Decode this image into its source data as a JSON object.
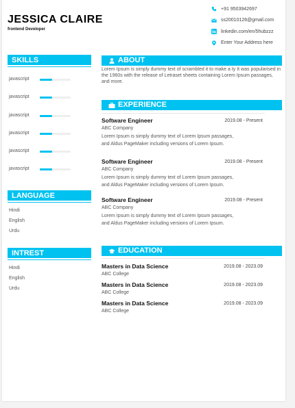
{
  "header": {
    "name": "JESSICA CLAIRE",
    "role": "frontend Developer"
  },
  "contact": [
    {
      "icon": "phone-icon",
      "text": "+91 9503942697"
    },
    {
      "icon": "email-icon",
      "text": "ss20010126@gmail.com"
    },
    {
      "icon": "linkedin-icon",
      "text": "linkedin.com/en/5hubzzz"
    },
    {
      "icon": "location-pin-icon",
      "text": "Enter Your Address here"
    }
  ],
  "colors": {
    "accent": "#00c2f0"
  },
  "skills": {
    "title": "SKILLS",
    "items": [
      {
        "label": "javascript",
        "level": 0.4
      },
      {
        "label": "javascript",
        "level": 0.4
      },
      {
        "label": "javascript",
        "level": 0.4
      },
      {
        "label": "javascript",
        "level": 0.4
      },
      {
        "label": "javascript",
        "level": 0.4
      },
      {
        "label": "javascript",
        "level": 0.4
      }
    ]
  },
  "language": {
    "title": "LANGUAGE",
    "items": [
      "Hindi",
      "English",
      "Urdu"
    ]
  },
  "interest": {
    "title": "INTREST",
    "items": [
      "Hindi",
      "English",
      "Urdu"
    ]
  },
  "about": {
    "title": "ABOUT",
    "text": "Lorem Ipsum is simply dummy text of scrambled it to make a ty It was popularised in the 1960s with the release of Letraset sheets containing Lorem Ipsum passages, and more."
  },
  "experience": {
    "title": "EXPERIENCE",
    "items": [
      {
        "title": "Software Engineer",
        "date": "2019.08 - Present",
        "company": "ABC Company",
        "desc": "Lorem Ipsum is simply dummy text of Lorem Ipsum passages, and Aldus PageMaker including versions of Lorem Ipsum."
      },
      {
        "title": "Software Engineer",
        "date": "2019.08 - Present",
        "company": "ABC Company",
        "desc": "Lorem Ipsum is simply dummy text of Lorem Ipsum passages, and Aldus PageMaker including versions of Lorem Ipsum."
      },
      {
        "title": "Software Engineer",
        "date": "2019.08 - Present",
        "company": "ABC Company",
        "desc": "Lorem Ipsum is simply dummy text of Lorem Ipsum passages, and Aldus PageMaker including versions of Lorem Ipsum."
      }
    ]
  },
  "education": {
    "title": "EDUCATION",
    "items": [
      {
        "degree": "Masters in Data Science",
        "date": "2019.08 - 2023.09",
        "school": "ABC College"
      },
      {
        "degree": "Masters in Data Science",
        "date": "2019.08 - 2023.09",
        "school": "ABC College"
      },
      {
        "degree": "Masters in Data Science",
        "date": "2019.08 - 2023.09",
        "school": "ABC College"
      }
    ]
  }
}
